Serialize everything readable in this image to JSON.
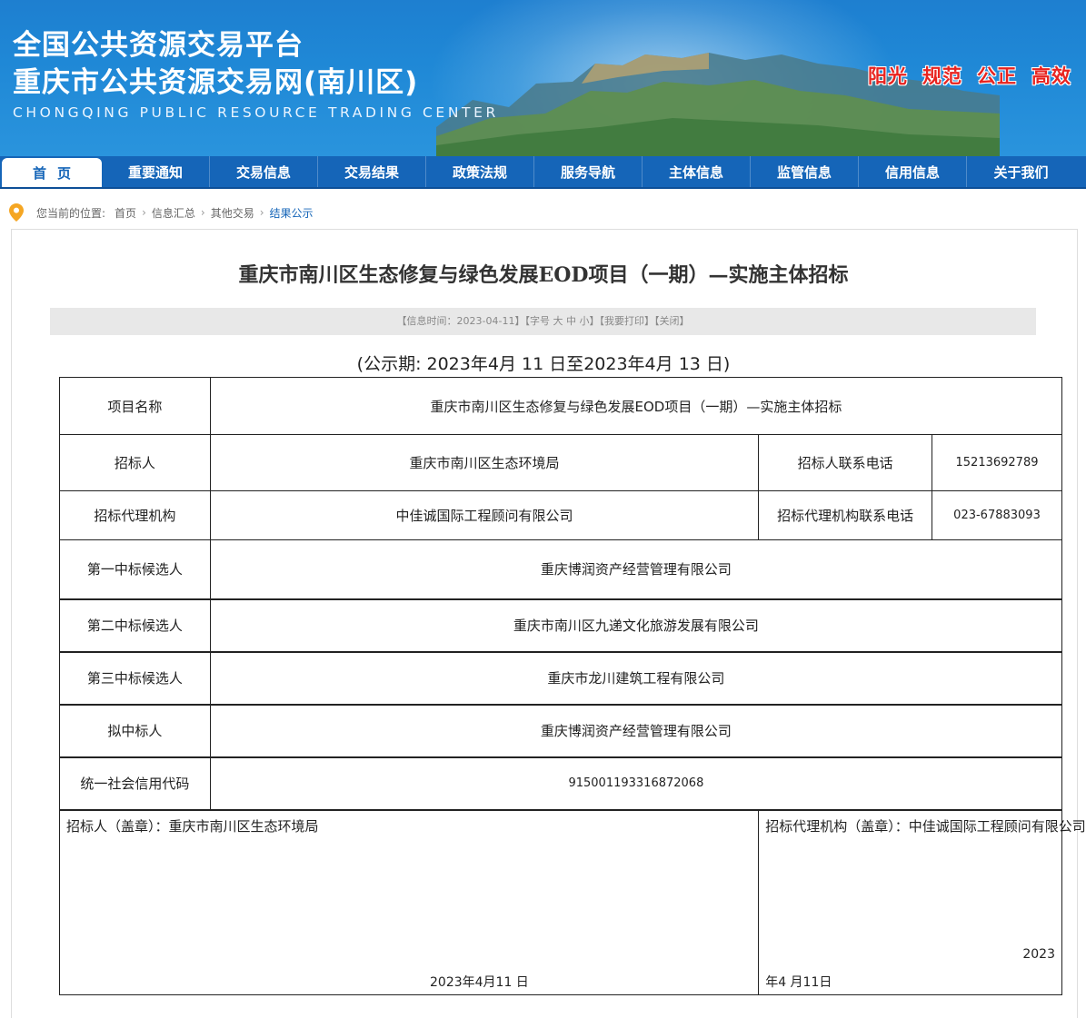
{
  "header": {
    "title_line1": "全国公共资源交易平台",
    "title_line2": "重庆市公共资源交易网(南川区)",
    "title_en": "CHONGQING PUBLIC RESOURCE TRADING CENTER",
    "slogans": [
      "阳光",
      "规范",
      "公正",
      "高效"
    ],
    "slogan_color": "#e8231f"
  },
  "nav": {
    "items": [
      "首页",
      "重要通知",
      "交易信息",
      "交易结果",
      "政策法规",
      "服务导航",
      "主体信息",
      "监管信息",
      "信用信息",
      "关于我们"
    ],
    "active": "首页",
    "bg_color": "#1565b8"
  },
  "breadcrumb": {
    "prefix": "您当前的位置:",
    "items": [
      "首页",
      "信息汇总",
      "其他交易",
      "结果公示"
    ]
  },
  "article": {
    "title": "重庆市南川区生态修复与绿色发展EOD项目（一期）—实施主体招标",
    "meta": {
      "time": "【信息时间：2023-04-11】",
      "font_prefix": "【字号 ",
      "font_big": "大",
      "font_mid": "中",
      "font_small": "小",
      "font_suffix": "】",
      "print": "【我要打印】",
      "close": "【关闭】"
    },
    "period": "(公示期:  2023年4月 11 日至2023年4月 13 日)"
  },
  "table": {
    "project_name_label": "项目名称",
    "project_name": "重庆市南川区生态修复与绿色发展EOD项目（一期）—实施主体招标",
    "tenderer_label": "招标人",
    "tenderer": "重庆市南川区生态环境局",
    "tenderer_phone_label": "招标人联系电话",
    "tenderer_phone": "15213692789",
    "agency_label": "招标代理机构",
    "agency": "中佳诚国际工程顾问有限公司",
    "agency_phone_label": "招标代理机构联系电话",
    "agency_phone": "023-67883093",
    "candidate1_label": "第一中标候选人",
    "candidate1": "重庆博润资产经营管理有限公司",
    "candidate2_label": "第二中标候选人",
    "candidate2": "重庆市南川区九递文化旅游发展有限公司",
    "candidate3_label": "第三中标候选人",
    "candidate3": "重庆市龙川建筑工程有限公司",
    "winner_label": "拟中标人",
    "winner": "重庆博润资产经营管理有限公司",
    "credit_code_label": "统一社会信用代码",
    "credit_code": "915001193316872068",
    "sign_left_label": "招标人（盖章）：重庆市南川区生态环境局",
    "sign_left_date": "2023年4月11 日",
    "sign_right_label": "招标代理机构（盖章）：中佳诚国际工程顾问有限公司",
    "sign_right_year": "2023",
    "sign_right_date": "年4 月11日"
  }
}
